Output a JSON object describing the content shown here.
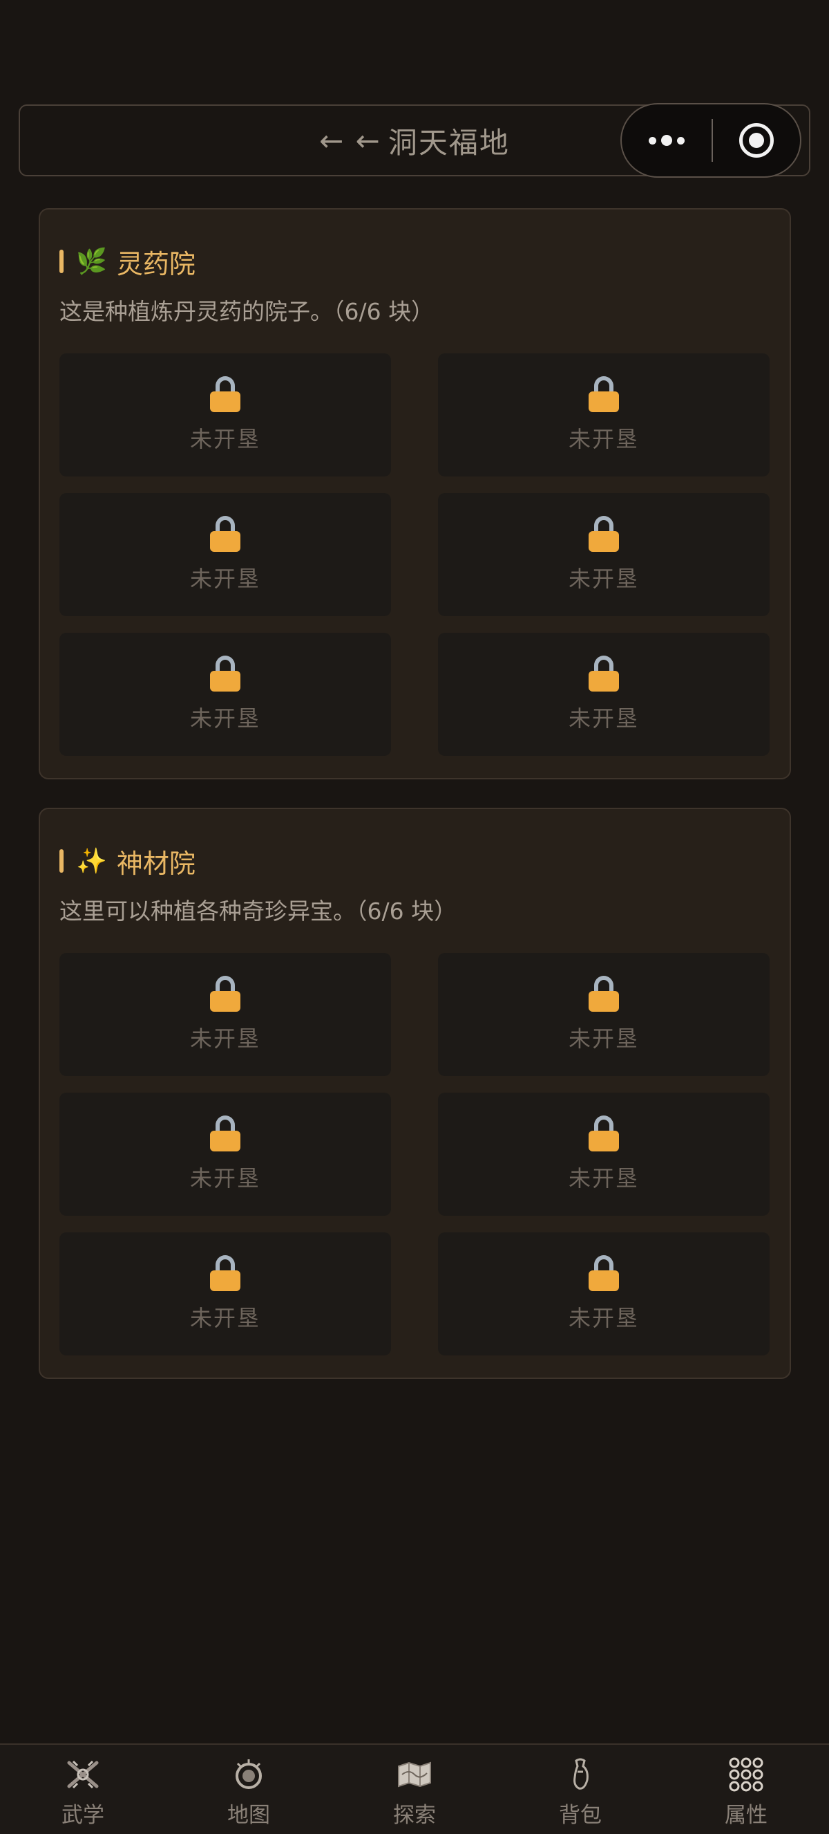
{
  "header": {
    "back_arrows": "← ←",
    "title": "洞天福地"
  },
  "sections": [
    {
      "emoji": "🌿",
      "title": "灵药院",
      "description": "这是种植炼丹灵药的院子。（6/6 块）",
      "plots": [
        {
          "label": "未开垦"
        },
        {
          "label": "未开垦"
        },
        {
          "label": "未开垦"
        },
        {
          "label": "未开垦"
        },
        {
          "label": "未开垦"
        },
        {
          "label": "未开垦"
        }
      ]
    },
    {
      "emoji": "✨",
      "title": "神材院",
      "description": "这里可以种植各种奇珍异宝。（6/6 块）",
      "plots": [
        {
          "label": "未开垦"
        },
        {
          "label": "未开垦"
        },
        {
          "label": "未开垦"
        },
        {
          "label": "未开垦"
        },
        {
          "label": "未开垦"
        },
        {
          "label": "未开垦"
        }
      ]
    }
  ],
  "tabbar": {
    "items": [
      {
        "label": "武学",
        "icon": "martial-arts-icon"
      },
      {
        "label": "地图",
        "icon": "map-icon"
      },
      {
        "label": "探索",
        "icon": "explore-icon"
      },
      {
        "label": "背包",
        "icon": "backpack-icon"
      },
      {
        "label": "属性",
        "icon": "attributes-icon"
      }
    ]
  },
  "colors": {
    "background": "#191512",
    "section_bg": "#272019",
    "accent": "#e9b764",
    "lock": "#f0a93c"
  }
}
